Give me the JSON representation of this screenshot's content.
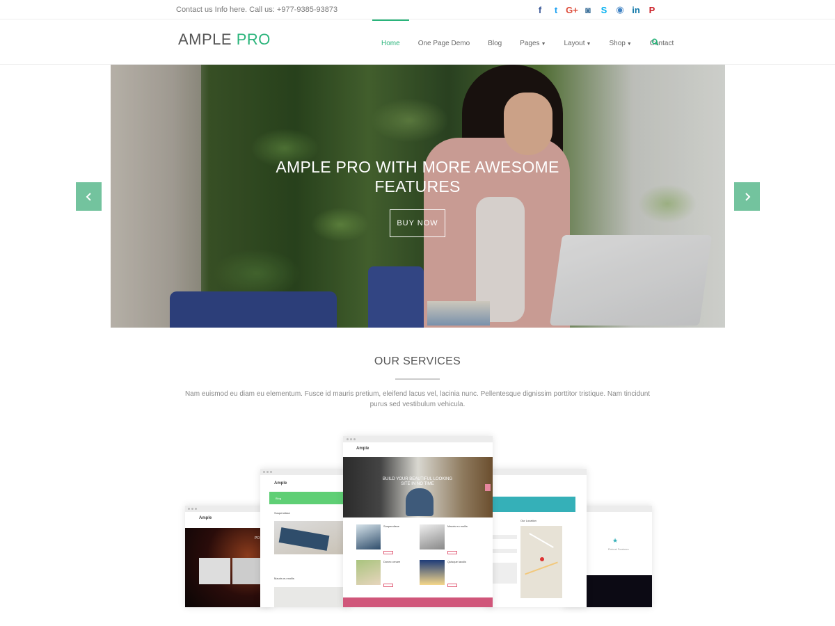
{
  "topbar": {
    "contact_text": "Contact us Info here. Call us: +977-9385-93873",
    "social_icons": [
      {
        "name": "facebook-icon",
        "glyph": "f",
        "color": "#3b5998"
      },
      {
        "name": "twitter-icon",
        "glyph": "t",
        "color": "#1da1f2"
      },
      {
        "name": "google-plus-icon",
        "glyph": "G+",
        "color": "#dd4b39"
      },
      {
        "name": "instagram-icon",
        "glyph": "◙",
        "color": "#3f729b"
      },
      {
        "name": "skype-icon",
        "glyph": "S",
        "color": "#00aff0"
      },
      {
        "name": "github-icon",
        "glyph": "◉",
        "color": "#4183c4"
      },
      {
        "name": "linkedin-icon",
        "glyph": "in",
        "color": "#0e76a8"
      },
      {
        "name": "pinterest-icon",
        "glyph": "P",
        "color": "#cb2027"
      }
    ]
  },
  "header": {
    "logo_main": "AMPLE",
    "logo_accent": "PRO",
    "nav": [
      {
        "label": "Home",
        "active": true,
        "has_caret": false
      },
      {
        "label": "One Page Demo",
        "active": false,
        "has_caret": false
      },
      {
        "label": "Blog",
        "active": false,
        "has_caret": false
      },
      {
        "label": "Pages",
        "active": false,
        "has_caret": true
      },
      {
        "label": "Layout",
        "active": false,
        "has_caret": true
      },
      {
        "label": "Shop",
        "active": false,
        "has_caret": true
      },
      {
        "label": "Contact",
        "active": false,
        "has_caret": false
      }
    ],
    "caret_glyph": "▼"
  },
  "slider": {
    "title": "AMPLE PRO WITH MORE AWESOME FEATURES",
    "button_label": "BUY NOW"
  },
  "services": {
    "title": "OUR SERVICES",
    "description": "Nam euismod eu diam eu elementum. Fusce id mauris pretium, eleifend lacus vel, lacinia nunc. Pellentesque dignissim porttitor tristique. Nam tincidunt purus sed vestibulum vehicula."
  },
  "mockups": {
    "center_logo": "Ample",
    "center_hero": "BUILD YOUR BEAUTIFUL LOOKING SITE IN NO TIME",
    "center_posts": [
      "Suspendisse",
      "Mauris eu mollis",
      "Donec ornare",
      "Quisque iaculis"
    ],
    "left2_logo": "Ample",
    "left2_band": "Blog",
    "left2_posts": [
      "Suspendisse",
      "Mauris eu mollis"
    ],
    "left1_logo": "Ample",
    "left1_text": "PO",
    "right2_heading": "Our Location",
    "right1_text": "Robust Features",
    "accent": "#2ab47b",
    "pink": "#d0567a",
    "teal": "#35b0b8"
  }
}
